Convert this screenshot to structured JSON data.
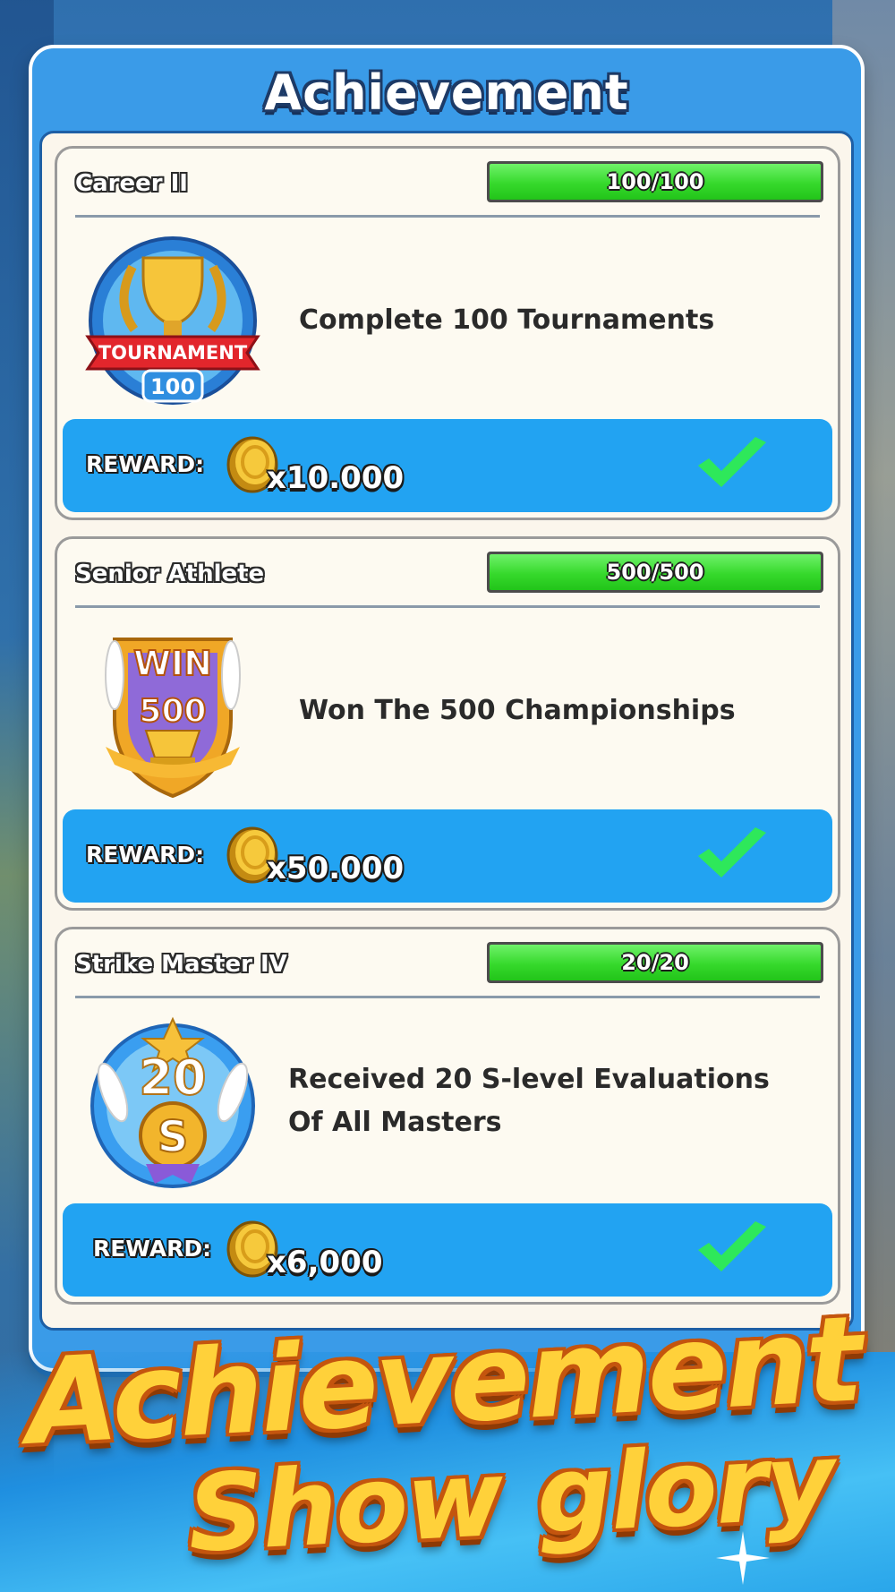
{
  "panel": {
    "title": "Achievement"
  },
  "achievements": [
    {
      "name": "Career II",
      "progress_text": "100/100",
      "progress": 1.0,
      "badge_icon": "tournament-trophy-badge",
      "badge_text_1": "TOURNAMENT",
      "badge_text_2": "100",
      "description": "Complete 100 Tournaments",
      "reward_label": "REWARD:",
      "reward_amount": "x10.000",
      "completed": true
    },
    {
      "name": "Senior Athlete",
      "progress_text": "500/500",
      "progress": 1.0,
      "badge_icon": "win-500-shield-badge",
      "badge_text_1": "WIN",
      "badge_text_2": "500",
      "description": "Won The 500 Championships",
      "reward_label": "REWARD:",
      "reward_amount": "x50.000",
      "completed": true
    },
    {
      "name": "Strike Master IV",
      "progress_text": "20/20",
      "progress": 1.0,
      "badge_icon": "strike-master-s-badge",
      "badge_text_1": "20",
      "badge_text_2": "S",
      "description": "Received 20 S-level Evaluations Of All Masters",
      "reward_label": "REWARD:",
      "reward_amount": "x6,000",
      "completed": true
    }
  ],
  "promo": {
    "line1": "Achievement",
    "line2": "Show glory"
  },
  "colors": {
    "panel_blue": "#3a9be8",
    "reward_bar_blue": "#22a3f2",
    "progress_green": "#36d92c",
    "check_green": "#2ee85a",
    "promo_gold": "#ffd13a"
  }
}
